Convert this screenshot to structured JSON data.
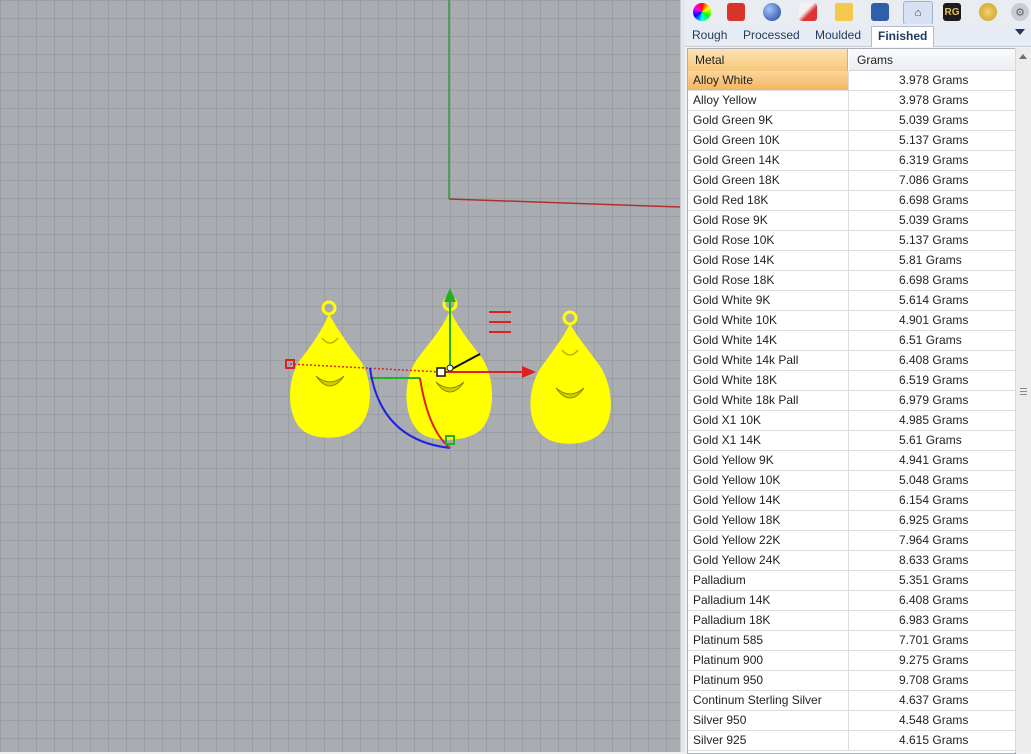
{
  "toolbar": {
    "icons": [
      "color-wheel-icon",
      "gem-shield-icon",
      "sphere-icon",
      "pen-icon",
      "folder-icon",
      "image-icon",
      "weight-basket-icon",
      "rg-logo-icon",
      "gold-disc-icon",
      "settings-gear-icon"
    ],
    "rg_label": "RG"
  },
  "tabs": [
    {
      "label": "Rough"
    },
    {
      "label": "Processed"
    },
    {
      "label": "Moulded"
    },
    {
      "label": "Finished",
      "active": true
    }
  ],
  "table": {
    "columns": [
      "Metal",
      "Grams"
    ],
    "selected_index": 0,
    "rows": [
      {
        "metal": "Alloy White",
        "grams": "3.978 Grams"
      },
      {
        "metal": "Alloy Yellow",
        "grams": "3.978 Grams"
      },
      {
        "metal": "Gold Green 9K",
        "grams": "5.039 Grams"
      },
      {
        "metal": "Gold Green 10K",
        "grams": "5.137 Grams"
      },
      {
        "metal": "Gold Green 14K",
        "grams": "6.319 Grams"
      },
      {
        "metal": "Gold Green 18K",
        "grams": "7.086 Grams"
      },
      {
        "metal": "Gold Red 18K",
        "grams": "6.698 Grams"
      },
      {
        "metal": "Gold Rose 9K",
        "grams": "5.039 Grams"
      },
      {
        "metal": "Gold Rose 10K",
        "grams": "5.137 Grams"
      },
      {
        "metal": "Gold Rose 14K",
        "grams": "5.81 Grams"
      },
      {
        "metal": "Gold Rose 18K",
        "grams": "6.698 Grams"
      },
      {
        "metal": "Gold White 9K",
        "grams": "5.614 Grams"
      },
      {
        "metal": "Gold White 10K",
        "grams": "4.901 Grams"
      },
      {
        "metal": "Gold White 14K",
        "grams": "6.51 Grams"
      },
      {
        "metal": "Gold White 14k Pall",
        "grams": "6.408 Grams"
      },
      {
        "metal": "Gold White 18K",
        "grams": "6.519 Grams"
      },
      {
        "metal": "Gold White 18k Pall",
        "grams": "6.979 Grams"
      },
      {
        "metal": "Gold X1 10K",
        "grams": "4.985 Grams"
      },
      {
        "metal": "Gold X1 14K",
        "grams": "5.61 Grams"
      },
      {
        "metal": "Gold Yellow 9K",
        "grams": "4.941 Grams"
      },
      {
        "metal": "Gold Yellow 10K",
        "grams": "5.048 Grams"
      },
      {
        "metal": "Gold Yellow 14K",
        "grams": "6.154 Grams"
      },
      {
        "metal": "Gold Yellow 18K",
        "grams": "6.925 Grams"
      },
      {
        "metal": "Gold Yellow 22K",
        "grams": "7.964 Grams"
      },
      {
        "metal": "Gold Yellow 24K",
        "grams": "8.633 Grams"
      },
      {
        "metal": "Palladium",
        "grams": "5.351 Grams"
      },
      {
        "metal": "Palladium 14K",
        "grams": "6.408 Grams"
      },
      {
        "metal": "Palladium 18K",
        "grams": "6.983 Grams"
      },
      {
        "metal": "Platinum 585",
        "grams": "7.701 Grams"
      },
      {
        "metal": "Platinum 900",
        "grams": "9.275 Grams"
      },
      {
        "metal": "Platinum 950",
        "grams": "9.708 Grams"
      },
      {
        "metal": "Continum Sterling Silver",
        "grams": "4.637 Grams"
      },
      {
        "metal": "Silver 950",
        "grams": "4.548 Grams"
      },
      {
        "metal": "Silver 925",
        "grams": "4.615 Grams"
      }
    ]
  },
  "viewport": {
    "objects": [
      "earring-pendant",
      "earring-pendant",
      "earring-pendant"
    ],
    "colors": {
      "object": "#ffff00",
      "x_axis": "#e02020",
      "y_axis": "#20a020",
      "z_axis": "#2020e0",
      "grid": "#9a9da2",
      "background": "#a9acb1"
    }
  }
}
